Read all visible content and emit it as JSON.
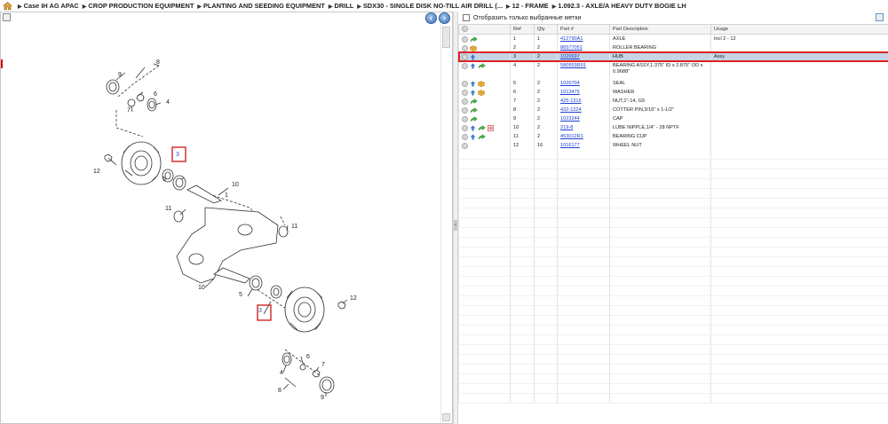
{
  "breadcrumb": [
    "Case IH AG APAC",
    "CROP PRODUCTION EQUIPMENT",
    "PLANTING AND SEEDING EQUIPMENT",
    "DRILL",
    "SDX30 - SINGLE DISK NO-TILL AIR DRILL (...",
    "12 - FRAME",
    "1.092.3 - AXLE/A HEAVY DUTY BOGIE LH"
  ],
  "filter": {
    "label": "Отобразить только выбранные метки",
    "checked": false
  },
  "table": {
    "headers": [
      "",
      "Ref",
      "Qty",
      "Part #",
      "Part Description",
      "Usage"
    ],
    "rows": [
      {
        "icons": [
          "circle",
          "green"
        ],
        "ref": "1",
        "qty": "1",
        "part": "412790A1",
        "desc": "AXLE",
        "usage": "Incl 2 - 12",
        "selected": false
      },
      {
        "icons": [
          "circle",
          "cube"
        ],
        "ref": "2",
        "qty": "2",
        "part": "86577051",
        "desc": "ROLLER BEARING",
        "usage": "",
        "selected": false
      },
      {
        "icons": [
          "circle",
          "blue"
        ],
        "ref": "3",
        "qty": "2",
        "part": "1020697",
        "desc": "HUB",
        "usage": "Assy",
        "selected": true
      },
      {
        "icons": [
          "circle",
          "blue",
          "green"
        ],
        "ref": "4",
        "qty": "2",
        "part": "580953R91",
        "desc": "BEARING ASSY,1.375\" ID x 2.875\" OD x 0.9688\"",
        "usage": "",
        "selected": false
      },
      {
        "icons": [
          "circle",
          "blue",
          "cube"
        ],
        "ref": "5",
        "qty": "2",
        "part": "1020704",
        "desc": "SEAL",
        "usage": "",
        "selected": false
      },
      {
        "icons": [
          "circle",
          "blue",
          "cube"
        ],
        "ref": "6",
        "qty": "2",
        "part": "1013475",
        "desc": "WASHER",
        "usage": "",
        "selected": false
      },
      {
        "icons": [
          "circle",
          "green"
        ],
        "ref": "7",
        "qty": "2",
        "part": "425-1316",
        "desc": "NUT,1\"-14, G5",
        "usage": "",
        "selected": false
      },
      {
        "icons": [
          "circle",
          "green"
        ],
        "ref": "8",
        "qty": "2",
        "part": "432-1224",
        "desc": "COTTER PIN,3/16\" x 1-1/2\"",
        "usage": "",
        "selected": false
      },
      {
        "icons": [
          "circle",
          "green"
        ],
        "ref": "9",
        "qty": "2",
        "part": "1023244",
        "desc": "CAP",
        "usage": "",
        "selected": false
      },
      {
        "icons": [
          "circle",
          "blue",
          "green",
          "red"
        ],
        "ref": "10",
        "qty": "2",
        "part": "219-8",
        "desc": "LUBE NIPPLE,1/4\" - 28 NPTF",
        "usage": "",
        "selected": false
      },
      {
        "icons": [
          "circle",
          "blue",
          "green"
        ],
        "ref": "11",
        "qty": "2",
        "part": "453012R1",
        "desc": "BEARING CUP",
        "usage": "",
        "selected": false
      },
      {
        "icons": [
          "circle"
        ],
        "ref": "12",
        "qty": "16",
        "part": "1016177",
        "desc": "WHEEL NUT",
        "usage": "",
        "selected": false
      }
    ],
    "empty_rows": 26
  },
  "diagram": {
    "callouts": [
      {
        "label": "8"
      },
      {
        "label": "9"
      },
      {
        "label": "6"
      },
      {
        "label": "4"
      },
      {
        "label": "7"
      },
      {
        "label": "3"
      },
      {
        "label": "12"
      },
      {
        "label": "5"
      },
      {
        "label": "10"
      },
      {
        "label": "1"
      },
      {
        "label": "11"
      },
      {
        "label": "11"
      },
      {
        "label": "10"
      },
      {
        "label": "5"
      },
      {
        "label": "3"
      },
      {
        "label": "12"
      },
      {
        "label": "6"
      },
      {
        "label": "4"
      },
      {
        "label": "7"
      },
      {
        "label": "8"
      },
      {
        "label": "9"
      }
    ]
  },
  "colors": {
    "selected_row": "#c6d4e6",
    "highlight": "#d22222",
    "link": "#1a3fd0"
  }
}
